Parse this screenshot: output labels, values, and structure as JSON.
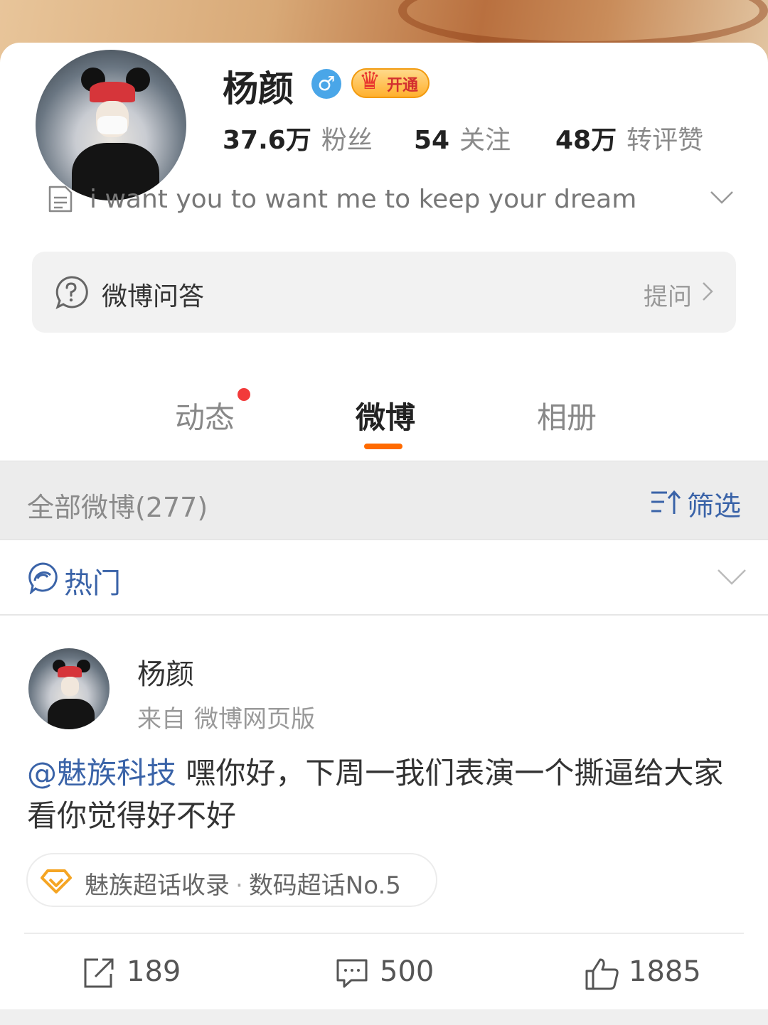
{
  "profile": {
    "name": "杨颜",
    "gender_symbol": "♂",
    "vip_label": "开通",
    "stats": {
      "fans_count": "37.6万",
      "fans_label": "粉丝",
      "following_count": "54",
      "following_label": "关注",
      "interactions_count": "48万",
      "interactions_label": "转评赞"
    },
    "bio": "i want you to want me to keep your dream"
  },
  "qa": {
    "label": "微博问答",
    "action_label": "提问"
  },
  "tabs": [
    {
      "label": "动态",
      "has_notification_dot": true
    },
    {
      "label": "微博",
      "active": true
    },
    {
      "label": "相册"
    }
  ],
  "filter_bar": {
    "all_label": "全部微博(277)",
    "filter_label": "筛选"
  },
  "hot_row": {
    "label": "热门"
  },
  "post": {
    "author": "杨颜",
    "source_prefix": "来自",
    "source_name": "微博网页版",
    "mention": "@魅族科技",
    "text": " 嘿你好，下周一我们表演一个撕逼给大家看你觉得好不好",
    "topic": {
      "name": "魅族超话收录",
      "separator": "·",
      "rank": "数码超话No.5"
    },
    "reposts": "189",
    "comments": "500",
    "likes": "1885"
  },
  "colors": {
    "accent_orange": "#ff6a00",
    "link_blue": "#3a63a8",
    "notification_red": "#f23a3a",
    "gender_blue": "#4aa6e8"
  }
}
